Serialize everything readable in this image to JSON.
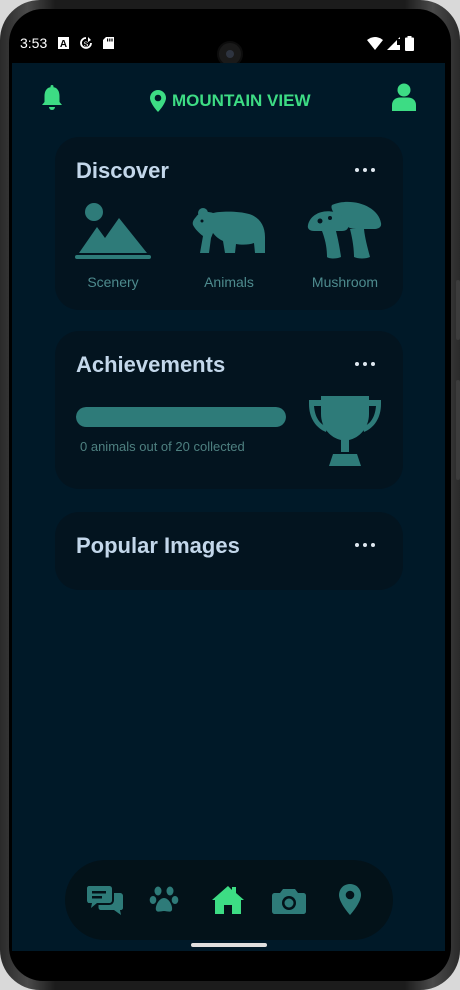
{
  "status_bar": {
    "time": "3:53",
    "icons": [
      "font-a-icon",
      "sync-icon",
      "sd-card-icon",
      "wifi-icon",
      "signal-icon",
      "battery-icon"
    ]
  },
  "header": {
    "left_icon": "bell-icon",
    "location": "MOUNTAIN VIEW",
    "location_icon": "map-pin-icon",
    "right_icon": "user-icon"
  },
  "discover": {
    "title": "Discover",
    "menu_icon": "more-horizontal-icon",
    "categories": [
      {
        "label": "Scenery",
        "icon": "landscape-icon"
      },
      {
        "label": "Animals",
        "icon": "bear-icon"
      },
      {
        "label": "Mushroom",
        "icon": "mushroom-icon"
      }
    ]
  },
  "achievements": {
    "title": "Achievements",
    "menu_icon": "more-horizontal-icon",
    "progress_text": "0 animals out of 20 collected",
    "progress_fraction": 1.0,
    "trophy_icon": "trophy-icon"
  },
  "popular": {
    "title": "Popular Images",
    "menu_icon": "more-horizontal-icon"
  },
  "bottom_nav": {
    "items": [
      {
        "icon": "chat-icon",
        "active": false
      },
      {
        "icon": "paw-icon",
        "active": false
      },
      {
        "icon": "home-icon",
        "active": true
      },
      {
        "icon": "camera-icon",
        "active": false
      },
      {
        "icon": "map-pin-icon",
        "active": false
      }
    ]
  },
  "colors": {
    "background": "#001928",
    "card": "#03141f",
    "accent": "#3ddc84",
    "icon_teal": "#2e7b79",
    "title": "#c3d7ea"
  }
}
